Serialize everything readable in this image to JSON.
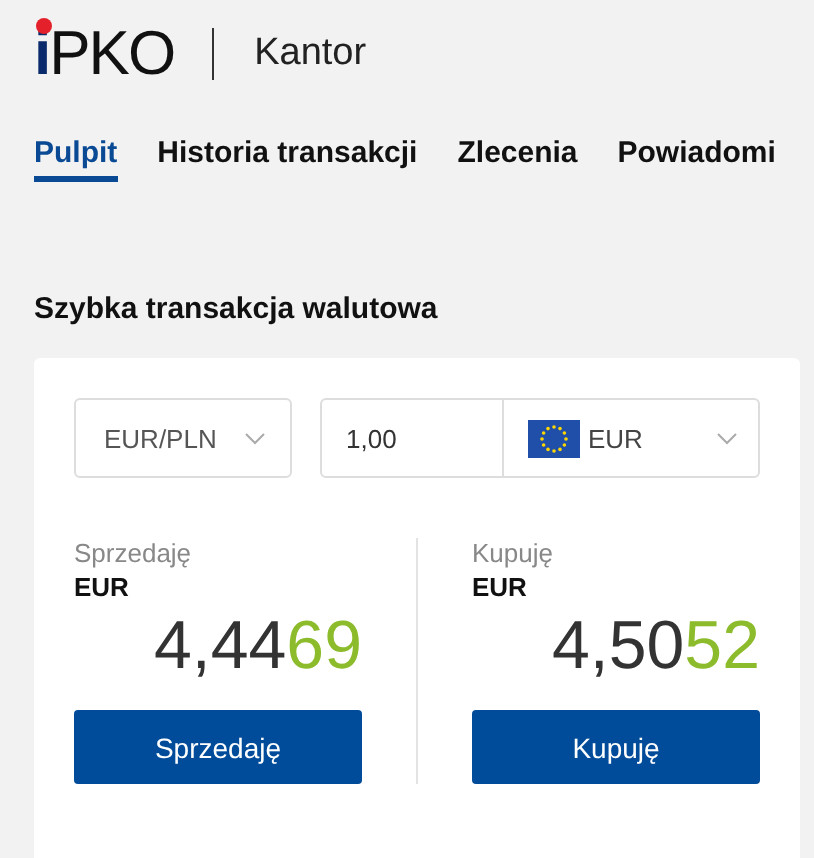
{
  "header": {
    "logo_prefix": "i",
    "logo_name": "PKO",
    "title": "Kantor"
  },
  "tabs": [
    {
      "label": "Pulpit",
      "selected": true
    },
    {
      "label": "Historia transakcji",
      "selected": false
    },
    {
      "label": "Zlecenia",
      "selected": false
    },
    {
      "label": "Powiadomi",
      "selected": false
    }
  ],
  "section_title": "Szybka transakcja walutowa",
  "form": {
    "pair": "EUR/PLN",
    "amount": "1,00",
    "currency": "EUR"
  },
  "offers": [
    {
      "label": "Sprzedaję",
      "currency": "EUR",
      "rate_main": "4,44",
      "rate_pips": "69",
      "button": "Sprzedaję"
    },
    {
      "label": "Kupuję",
      "currency": "EUR",
      "rate_main": "4,50",
      "rate_pips": "52",
      "button": "Kupuję"
    }
  ]
}
